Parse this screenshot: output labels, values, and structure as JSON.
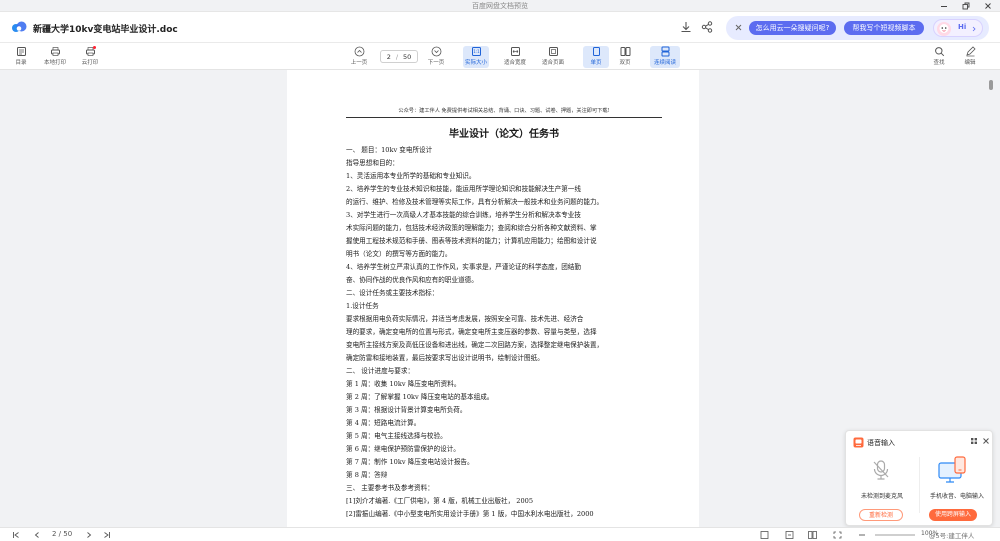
{
  "window": {
    "title": "百度网盘文档预览",
    "min_icon": "minimize-icon",
    "restore_icon": "restore-icon",
    "close_icon": "close-icon"
  },
  "header": {
    "app_icon": "baidu-netdisk-cloud-icon",
    "doc_title": "新疆大学10kv变电站毕业设计.doc",
    "download_icon": "download-icon",
    "share_icon": "share-icon",
    "ai": {
      "close_icon": "close-icon",
      "chip1": "怎么用云一朵搜疑问呢?",
      "chip2": "帮我写个短视频脚本",
      "hi": "Hi"
    }
  },
  "toolbar": {
    "left": [
      {
        "label": "目录",
        "icon": "list-icon"
      },
      {
        "label": "本地打印",
        "icon": "printer-icon"
      },
      {
        "label": "云打印",
        "icon": "cloud-print-icon"
      }
    ],
    "prev_label": "上一页",
    "page_current": "2",
    "page_total": "50",
    "page_sep": "/",
    "next_label": "下一页",
    "views": [
      {
        "label": "实际大小",
        "active": true
      },
      {
        "label": "适合宽度",
        "active": false
      },
      {
        "label": "适合页面",
        "active": false
      },
      {
        "label": "单页",
        "active": true
      },
      {
        "label": "双页",
        "active": false
      },
      {
        "label": "连续阅读",
        "active": true
      }
    ],
    "right": [
      {
        "label": "查找",
        "icon": "search-icon"
      },
      {
        "label": "编辑",
        "icon": "edit-icon"
      }
    ]
  },
  "document": {
    "header_line": "公众号：建工伴人 免费提供考试相关总结、背诵、口诀、习题、试卷、押题，关注即可下载!",
    "heading": "毕业设计（论文）任务书",
    "lines": [
      "一、    题目：10kv 变电所设计",
      "    指导思想和目的：",
      "    1、灵活运用本专业所学的基础和专业知识。",
      "    2、培养学生的专业技术知识和技能，能运用所学理论知识和技能解决生产第一线",
      "的运行、维护、检修及技术管理等实际工作，具有分析解决一般技术和业务问题的能力。",
      "    3、对学生进行一次高级人才基本技能的综合训练，培养学生分析和解决本专业技",
      "术实际问题的能力，包括技术经济政策的理解能力；查阅和综合分析各种文献资料、掌",
      "握使用工程技术规范和手册、图表等技术资料的能力；计算机应用能力；绘图和设计说",
      "明书（论文）的撰写等方面的能力。",
      "    4、培养学生树立严肃认真的工作作风，实事求是，严谨论证的科学态度，团结勤",
      "奋、协同作战的优良作风和应有的职业道德。",
      "    二、设计任务或主要技术指标：",
      "    1.设计任务",
      "    要求根据用电负荷实际情况，并适当考虑发展，按照安全可靠、技术先进、经济合",
      "理的要求，确定变电所的位置与形式，确定变电所主变压器的参数、容量与类型，选择",
      "变电所主接线方案及高低压设备和进出线，确定二次回路方案，选择整定继电保护装置，",
      "确定防雷和接地装置，最后按要求写出设计说明书，绘制设计图纸。",
      "    二、    设计进度与要求：",
      "    第 1 周：收集 10kv 降压变电所资料。",
      "    第 2 周：了解掌握 10kv 降压变电站的基本组成。",
      "    第 3 周：根据设计背景计算变电所负荷。",
      "    第 4 周：短路电流计算。",
      "    第 5 周：电气主接线选择与校验。",
      "    第 6 周：继电保护预防雷保护的设计。",
      "    第 7 周：制作 10kv 降压变电站设计报告。",
      "    第 8 周：答辩",
      "    三、    主要参考书及参考资料：",
      "    [1]刘介才编著.《工厂供电》，第 4 版，机械工业出版社，   2005",
      "    [2]雷振山编著.《中小型变电所实用设计手册》第 1 版，中国水利水电出版社，2000"
    ]
  },
  "statusbar": {
    "first_icon": "first-page-icon",
    "prev_icon": "prev-icon",
    "page": "2 / 50",
    "next_icon": "next-icon",
    "last_icon": "last-page-icon",
    "zoom": "100%",
    "watermark": "@5号:建工伴人"
  },
  "voice_panel": {
    "title": "语音输入",
    "left_label": "未检测到麦克风",
    "left_button": "重新检测",
    "right_label": "手机收音、电脑输入",
    "right_button": "使用跨屏输入",
    "accent": "#ff6a3d"
  },
  "colors": {
    "accent_blue": "#1f63d8",
    "active_bg": "#dde8fb",
    "chip": "#5c6cf0",
    "voice_orange": "#ff6a3d"
  }
}
